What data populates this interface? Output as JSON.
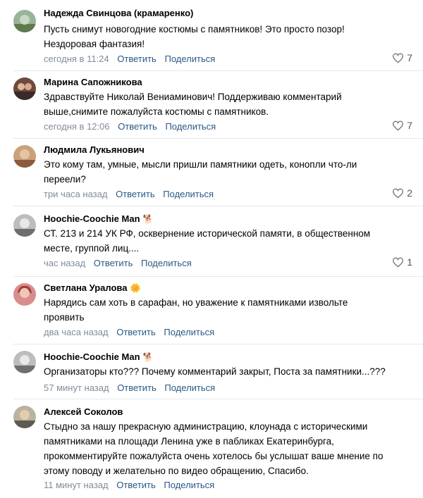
{
  "comments": [
    {
      "author": "Надежда Свинцова (крамаренко)",
      "lines": [
        "Пусть снимут новогодние костюмы с памятников! Это просто позор!",
        "Нездоровая фантазия!"
      ],
      "time": "сегодня в 11:24",
      "reply": "Ответить",
      "share": "Поделиться",
      "likes": "7",
      "avatar": "landscape-avatar"
    },
    {
      "author": "Марина Сапожникова",
      "lines": [
        "Здравствуйте Николай Вениаминович! Поддерживаю комментарий",
        "выше,снимите пожалуйста костюмы с памятников."
      ],
      "time": "сегодня в 12:06",
      "reply": "Ответить",
      "share": "Поделиться",
      "likes": "7",
      "avatar": "couple-avatar"
    },
    {
      "author": "Людмила Лукьянович",
      "lines": [
        "Это кому там, умные, мысли пришли памятники одеть, конопли что-ли",
        "переели?"
      ],
      "time": "три часа назад",
      "reply": "Ответить",
      "share": "Поделиться",
      "likes": "2",
      "avatar": "woman-avatar"
    },
    {
      "author": "Hoochie-Coochie Man",
      "emoji": "🐕",
      "lines": [
        "СТ. 213 и 214 УК РФ, осквернение исторической памяти, в общественном",
        "месте, группой лиц...."
      ],
      "time": "час назад",
      "reply": "Ответить",
      "share": "Поделиться",
      "likes": "1",
      "avatar": "man-avatar"
    },
    {
      "author": "Светлана Уралова",
      "emoji": "🌼",
      "lines": [
        "Нарядись сам хоть в сарафан, но уважение к памятниками извольте",
        "проявить"
      ],
      "time": "два часа назад",
      "reply": "Ответить",
      "share": "Поделиться",
      "likes": "",
      "avatar": "redhead-avatar"
    },
    {
      "author": "Hoochie-Coochie Man",
      "emoji": "🐕",
      "lines": [
        "Организаторы кто??? Почему комментарий закрыт, Поста за памятники...???"
      ],
      "time": "57 минут назад",
      "reply": "Ответить",
      "share": "Поделиться",
      "likes": "",
      "avatar": "man-avatar"
    },
    {
      "author": "Алексей Соколов",
      "lines": [
        "Стыдно за нашу прекрасную администрацию, клоунада с историческими",
        "памятниками на площади Ленина уже в пабликах Екатеринбурга,",
        "прокомментируйте пожалуйста очень хотелось бы услышат ваше мнение по",
        "этому поводу и желательно по видео обращению, Спасибо."
      ],
      "time": "11 минут назад",
      "reply": "Ответить",
      "share": "Поделиться",
      "likes": "",
      "avatar": "man2-avatar"
    }
  ],
  "colors": {
    "link": "#2a5885",
    "time": "#818c99",
    "separator": "#e7e8ec"
  }
}
